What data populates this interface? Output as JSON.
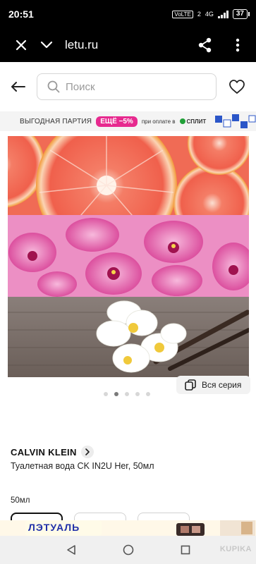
{
  "status_bar": {
    "time": "20:51",
    "network_label": "VoLTE",
    "network_sub": "2",
    "network_type": "4G",
    "battery": "37"
  },
  "browser": {
    "url": "letu.ru",
    "icons": [
      "close-icon",
      "chevron-down-icon",
      "share-icon",
      "more-vertical-icon"
    ]
  },
  "header": {
    "search_placeholder": "Поиск",
    "icons": [
      "back-arrow-icon",
      "search-icon",
      "heart-icon"
    ]
  },
  "promo": {
    "title": "ВЫГОДНАЯ ПАРТИЯ",
    "badge": "ЕЩЁ −5%",
    "note": "при оплате в",
    "logo_text": "СПЛИТ"
  },
  "gallery": {
    "series_button": "Вся серия",
    "total_slides": 5,
    "active_slide": 2
  },
  "product": {
    "brand": "CALVIN KLEIN",
    "name": "Туалетная вода CK IN2U Her, 50мл",
    "volume_label": "50мл"
  },
  "bottom_ad": {
    "logo_text": "ЛЭТУАЛЬ"
  },
  "watermark": "KUPIKA",
  "colors": {
    "accent": "#e72a8f",
    "split_green": "#21a038",
    "status_bg": "#000000"
  }
}
